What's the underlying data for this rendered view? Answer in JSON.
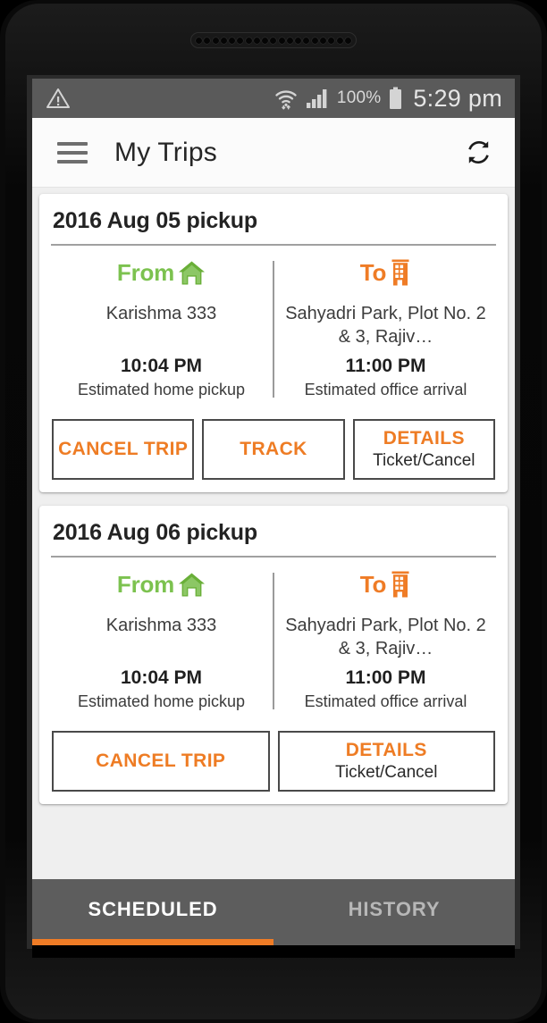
{
  "device": {
    "speaker_hole_count": 19
  },
  "status_bar": {
    "warning_icon": "warning-triangle-icon",
    "wifi_icon": "wifi-icon",
    "signal_icon": "signal-bars-icon",
    "battery_percent": "100%",
    "battery_icon": "battery-full-icon",
    "time": "5:29 pm",
    "background_color": "#5a5a5a"
  },
  "app_bar": {
    "menu_icon": "hamburger-menu-icon",
    "title": "My Trips",
    "refresh_icon": "refresh-icon"
  },
  "colors": {
    "accent_orange": "#ee7c24",
    "from_green": "#7cc24f",
    "tab_bar_gray": "#5d5d5d",
    "page_background": "#efefef"
  },
  "trips": [
    {
      "title": "2016 Aug 05 pickup",
      "from": {
        "label": "From",
        "icon": "home-icon",
        "place": "Karishma 333",
        "time": "10:04 PM",
        "note": "Estimated home pickup"
      },
      "to": {
        "label": "To",
        "icon": "office-building-icon",
        "place": "Sahyadri Park, Plot No. 2 & 3, Rajiv…",
        "time": "11:00 PM",
        "note": "Estimated office arrival"
      },
      "actions": [
        {
          "label": "CANCEL TRIP",
          "sub": ""
        },
        {
          "label": "TRACK",
          "sub": ""
        },
        {
          "label": "DETAILS",
          "sub": "Ticket/Cancel"
        }
      ]
    },
    {
      "title": "2016 Aug 06 pickup",
      "from": {
        "label": "From",
        "icon": "home-icon",
        "place": "Karishma 333",
        "time": "10:04 PM",
        "note": "Estimated home pickup"
      },
      "to": {
        "label": "To",
        "icon": "office-building-icon",
        "place": "Sahyadri Park, Plot No. 2 & 3, Rajiv…",
        "time": "11:00 PM",
        "note": "Estimated office arrival"
      },
      "actions": [
        {
          "label": "CANCEL TRIP",
          "sub": ""
        },
        {
          "label": "DETAILS",
          "sub": "Ticket/Cancel"
        }
      ]
    }
  ],
  "tabs": [
    {
      "label": "SCHEDULED",
      "active": true
    },
    {
      "label": "HISTORY",
      "active": false
    }
  ]
}
